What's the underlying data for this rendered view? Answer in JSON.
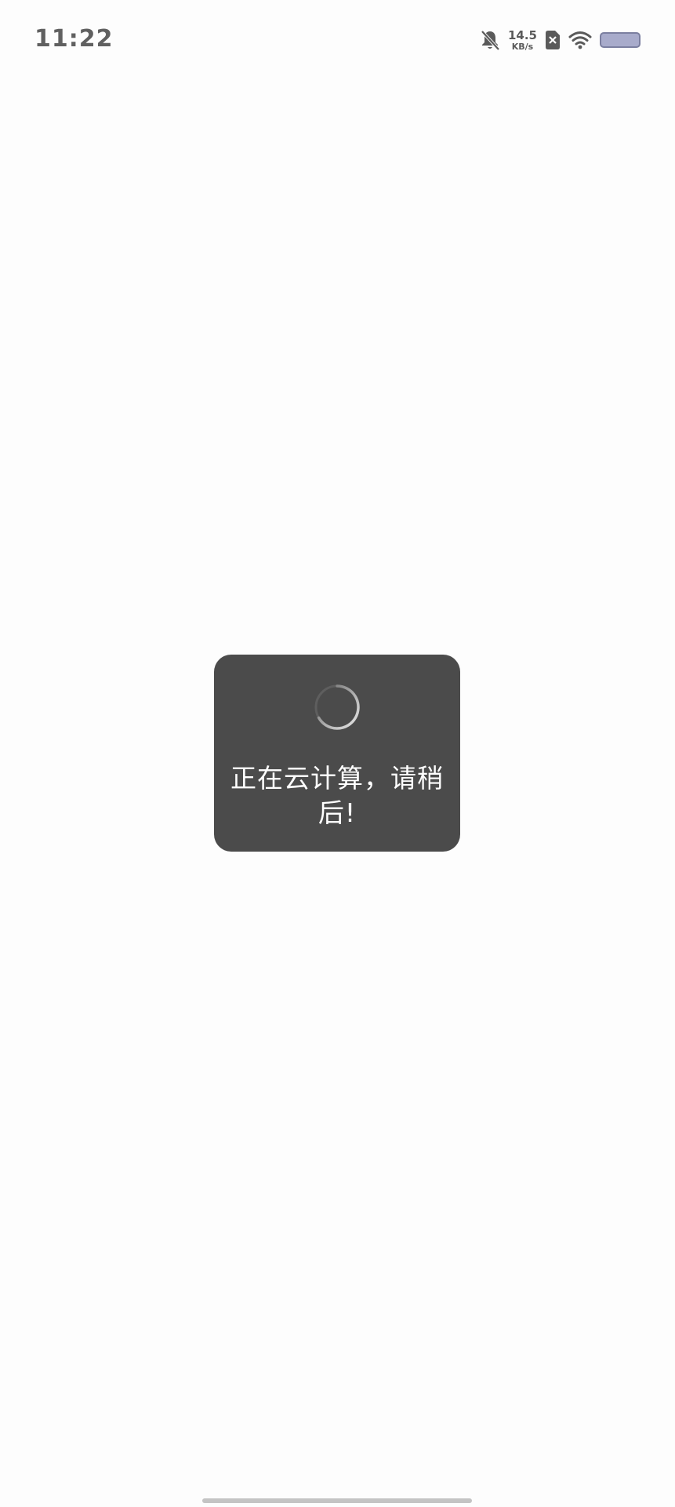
{
  "status_bar": {
    "time": "11:22",
    "net_speed_value": "14.5",
    "net_speed_unit": "KB/s",
    "icons": [
      "bell-muted-icon",
      "sim-x-icon",
      "wifi-icon",
      "battery-icon"
    ],
    "battery_color": "#a8abcb"
  },
  "loading": {
    "message": "正在云计算，请稍后!",
    "background_color": "#4b4b4b",
    "icon": "spinner-icon"
  }
}
